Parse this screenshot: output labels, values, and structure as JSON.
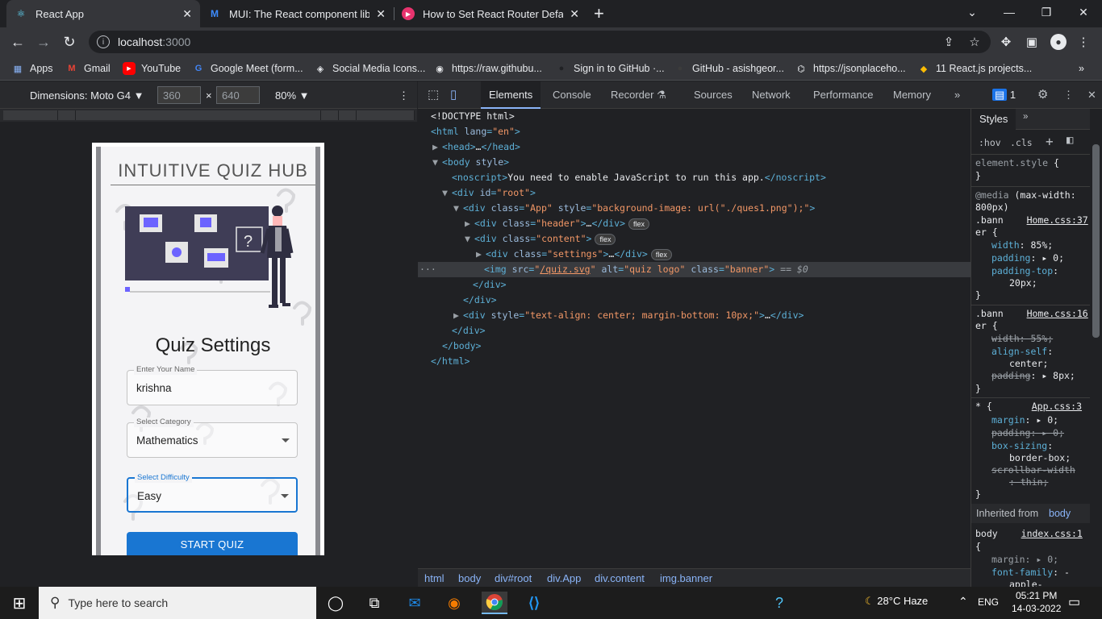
{
  "browser": {
    "tabs": [
      {
        "title": "React App",
        "favicon": "react-icon",
        "active": true
      },
      {
        "title": "MUI: The React component librar",
        "favicon": "mui-icon",
        "active": false
      },
      {
        "title": "How to Set React Router Default",
        "favicon": "video-icon",
        "active": false
      }
    ],
    "url_host": "localhost",
    "url_port": ":3000",
    "bookmarks": [
      {
        "label": "Apps",
        "icon": "apps-grid-icon"
      },
      {
        "label": "Gmail",
        "icon": "gmail-icon"
      },
      {
        "label": "YouTube",
        "icon": "youtube-icon"
      },
      {
        "label": "Google Meet (form...",
        "icon": "google-icon"
      },
      {
        "label": "Social Media Icons...",
        "icon": "cube-icon"
      },
      {
        "label": "https://raw.githubu...",
        "icon": "globe-icon"
      },
      {
        "label": "Sign in to GitHub ·...",
        "icon": "github-icon"
      },
      {
        "label": "GitHub - asishgeor...",
        "icon": "github-icon"
      },
      {
        "label": "https://jsonplaceho...",
        "icon": "placeholder-icon"
      },
      {
        "label": "11 React.js projects...",
        "icon": "bookmark-icon"
      }
    ]
  },
  "device_toolbar": {
    "dimensions_label": "Dimensions: Moto G4",
    "width": "360",
    "height": "640",
    "zoom": "80%"
  },
  "app": {
    "title": "INTUITIVE QUIZ HUB",
    "settings_heading": "Quiz Settings",
    "name_label": "Enter Your Name",
    "name_value": "krishna",
    "category_label": "Select Category",
    "category_value": "Mathematics",
    "difficulty_label": "Select Difficulty",
    "difficulty_value": "Easy",
    "start_button": "START QUIZ"
  },
  "devtools": {
    "tabs": [
      "Elements",
      "Console",
      "Recorder",
      "Sources",
      "Network",
      "Performance",
      "Memory"
    ],
    "issues_count": "1",
    "dom": {
      "doctype": "<!DOCTYPE html>",
      "noscript_text": "You need to enable JavaScript to run this app.",
      "bg_style": "background-image: url(\"./ques1.png\");",
      "img_src": "/quiz.svg",
      "img_alt": "quiz logo",
      "inline_style": "text-align: center; margin-bottom: 10px;",
      "selected_marker": "== $0"
    },
    "breadcrumbs": [
      "html",
      "body",
      "div#root",
      "div.App",
      "div.content",
      "img.banner"
    ],
    "styles_tab": "Styles",
    "filter_hov": ":hov",
    "filter_cls": ".cls",
    "inherited_label": "Inherited from",
    "inherited_from": "body"
  },
  "taskbar": {
    "search_placeholder": "Type here to search",
    "weather": "28°C  Haze",
    "language": "ENG",
    "time": "05:21 PM",
    "date": "14-03-2022"
  },
  "colors": {
    "accent": "#1976d2",
    "chrome_dark": "#202124",
    "devtools_tag": "#5db0d7"
  }
}
